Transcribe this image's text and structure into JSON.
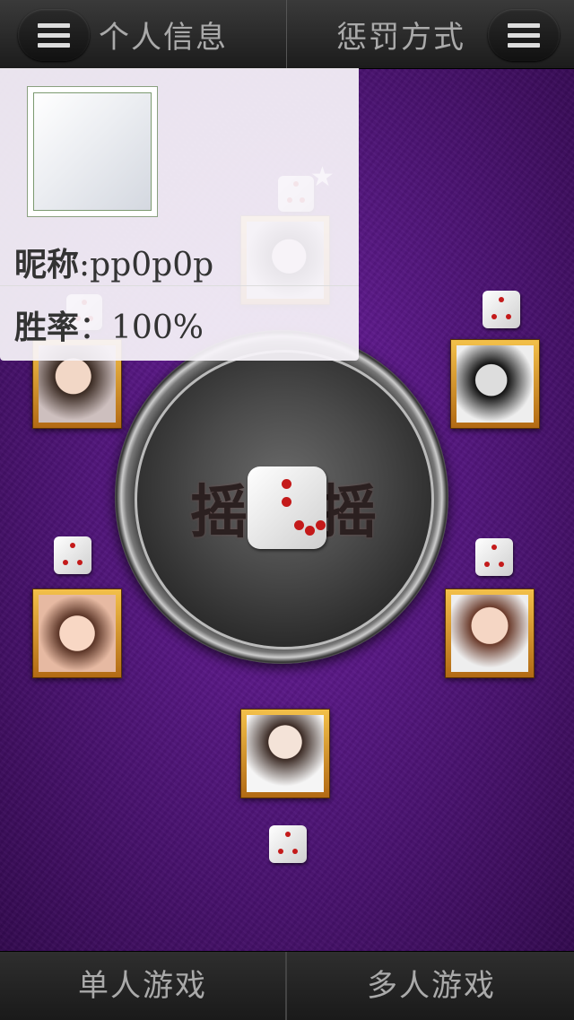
{
  "header": {
    "left_tab": "个人信息",
    "right_tab": "惩罚方式",
    "left_menu_icon": "menu-icon",
    "right_menu_icon": "menu-icon"
  },
  "profile": {
    "nickname_label": "昵称",
    "nickname_sep": ":",
    "nickname_value": "pp0p0p",
    "winrate_label": "胜率",
    "winrate_sep": "：",
    "winrate_value": "100%"
  },
  "shaker": {
    "left_char": "摇",
    "right_char": "摇",
    "center_icon": "dice-icon"
  },
  "footer": {
    "single_player": "单人游戏",
    "multi_player": "多人游戏"
  },
  "colors": {
    "background": "#52167c",
    "pip": "#c41a1a",
    "frame": "#e0a030"
  }
}
